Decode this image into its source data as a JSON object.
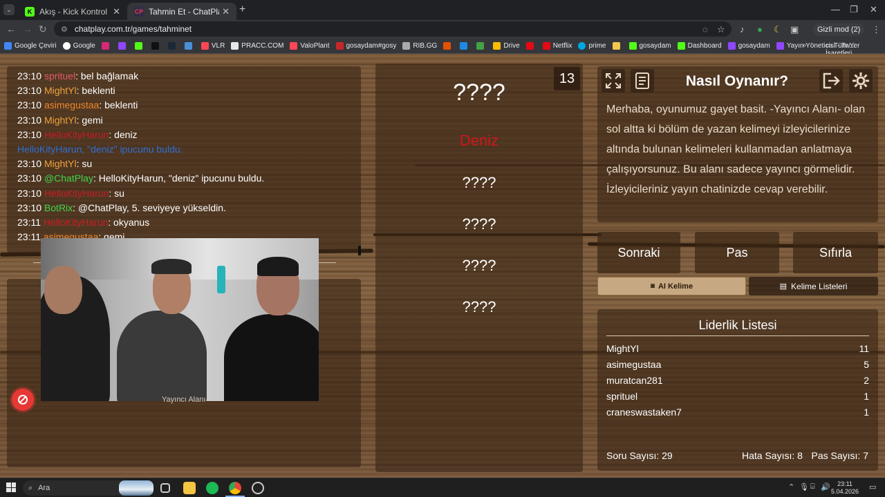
{
  "browser": {
    "tabs": [
      {
        "title": "Akış - Kick Kontrol Paneli",
        "active": false
      },
      {
        "title": "Tahmin Et - ChatPlay",
        "active": true
      }
    ],
    "url": "chatplay.com.tr/games/tahminet",
    "incognito_label": "Gizli mod (2)",
    "bookmarks": [
      "Google Çeviri",
      "Google",
      "VLR",
      "PRACC.COM",
      "ValoPlant",
      "gosaydam#gosy",
      "RIB.GG",
      "Drive",
      "Netflix",
      "prime",
      "gosaydam",
      "Dashboard",
      "gosaydam",
      "Yayın Yöneticisi - Tw..."
    ],
    "all_bookmarks_label": "Tüm Yer İşaretleri"
  },
  "chat": {
    "messages": [
      {
        "time": "23:10",
        "user": "sprituel",
        "user_color": "#e25b6b",
        "text": ": bel bağlamak"
      },
      {
        "time": "23:10",
        "user": "MightYl",
        "user_color": "#f0a33c",
        "text": ": beklenti"
      },
      {
        "time": "23:10",
        "user": "asimegustaa",
        "user_color": "#f08a2c",
        "text": ": beklenti"
      },
      {
        "time": "23:10",
        "user": "MightYl",
        "user_color": "#f0a33c",
        "text": ": gemi"
      },
      {
        "time": "23:10",
        "user": "HelloKityHarun",
        "user_color": "#c81d25",
        "text": ": deniz"
      },
      {
        "time": "",
        "user": "HelloKityHarun, \"deniz\" ipucunu buldu.",
        "user_color": "#2f6fd1",
        "text": ""
      },
      {
        "time": "23:10",
        "user": "MightYl",
        "user_color": "#f0a33c",
        "text": ": su"
      },
      {
        "time": "23:10",
        "user": "@ChatPlay",
        "user_color": "#3fd44a",
        "text": ": HelloKityHarun, \"deniz\" ipucunu buldu."
      },
      {
        "time": "23:10",
        "user": "HelloKityHarun",
        "user_color": "#c81d25",
        "text": ": su"
      },
      {
        "time": "23:10",
        "user": "BotRix",
        "user_color": "#3fd44a",
        "text": ": @ChatPlay, 5. seviyeye yükseldin."
      },
      {
        "time": "23:11",
        "user": "HelloKityHarun",
        "user_color": "#c81d25",
        "text": ": okyanus"
      },
      {
        "time": "23:11",
        "user": "asimegustaa",
        "user_color": "#f08a2c",
        "text": ": gemi"
      }
    ]
  },
  "camera": {
    "caption": "Yayıncı Alanı"
  },
  "game": {
    "counter": "13",
    "main_word": "????",
    "found_word": "Deniz",
    "hidden_words": [
      "????",
      "????",
      "????",
      "????"
    ]
  },
  "info": {
    "title": "Nasıl Oynanır?",
    "text": "Merhaba, oyunumuz gayet basit. -Yayıncı Alanı- olan sol altta ki bölüm de yazan kelimeyi izleyicilerinize altında bulunan kelimeleri kullanmadan anlatmaya çalışıyorsunuz. Bu alanı sadece yayıncı görmelidir. İzleyicileriniz yayın chatinizde cevap verebilir."
  },
  "actions": {
    "next": "Sonraki",
    "pass": "Pas",
    "reset": "Sıfırla",
    "ai_word": "AI Kelime",
    "word_lists": "Kelime Listeleri"
  },
  "leaderboard": {
    "title": "Liderlik Listesi",
    "rows": [
      {
        "name": "MightYl",
        "score": "11"
      },
      {
        "name": "asimegustaa",
        "score": "5"
      },
      {
        "name": "muratcan281",
        "score": "2"
      },
      {
        "name": "sprituel",
        "score": "1"
      },
      {
        "name": "craneswastaken7",
        "score": "1"
      }
    ]
  },
  "stats": {
    "questions": "Soru Sayısı: 29",
    "errors": "Hata Sayısı: 8",
    "passes": "Pas Sayısı: 7"
  },
  "taskbar": {
    "search_label": "Ara",
    "time": "23:11",
    "date": "5.04.2026"
  }
}
